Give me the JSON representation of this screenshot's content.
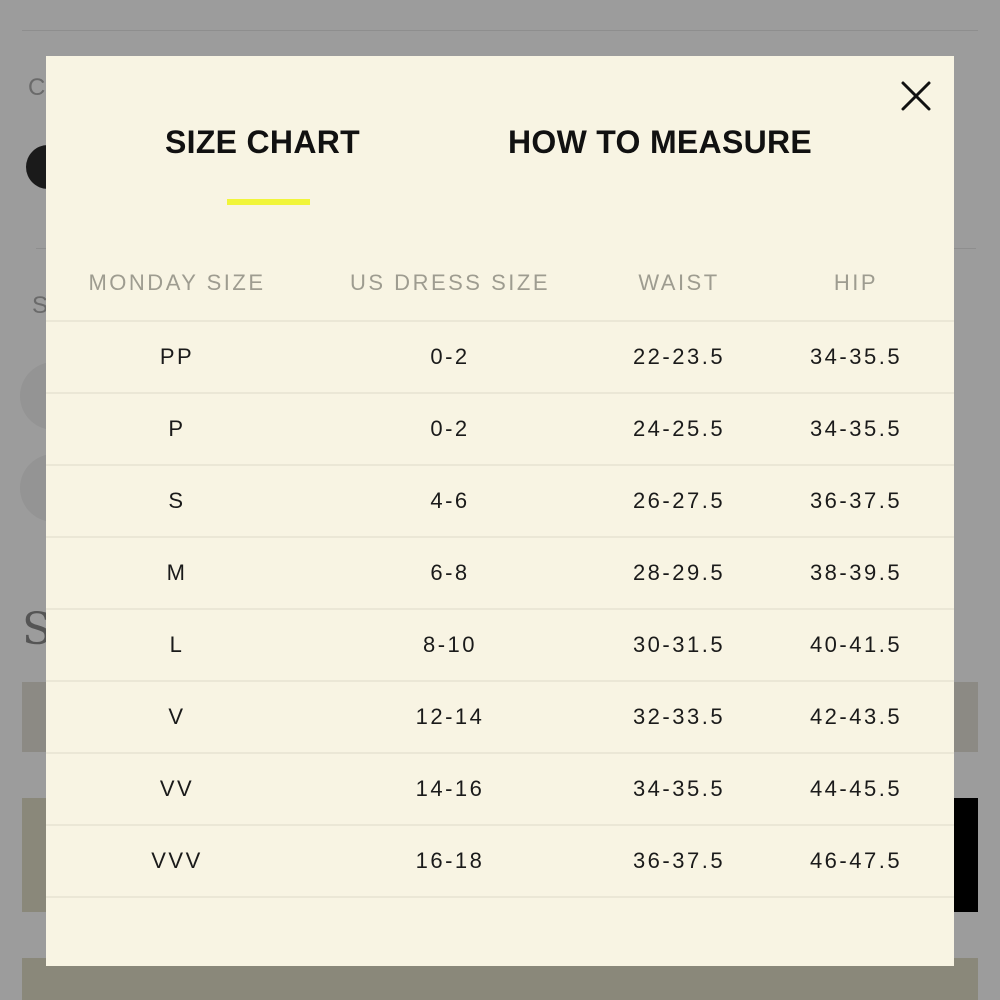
{
  "background_page": {
    "label_c": "C",
    "label_s": "S",
    "heading_s": "S"
  },
  "modal": {
    "close_icon": "close-icon",
    "tabs": [
      {
        "label": "SIZE CHART",
        "active": true
      },
      {
        "label": "HOW TO MEASURE",
        "active": false
      }
    ],
    "accent_color": "#f1f53a",
    "table": {
      "headers": [
        "MONDAY SIZE",
        "US DRESS SIZE",
        "WAIST",
        "HIP"
      ],
      "rows": [
        [
          "PP",
          "0-2",
          "22-23.5",
          "34-35.5"
        ],
        [
          "P",
          "0-2",
          "24-25.5",
          "34-35.5"
        ],
        [
          "S",
          "4-6",
          "26-27.5",
          "36-37.5"
        ],
        [
          "M",
          "6-8",
          "28-29.5",
          "38-39.5"
        ],
        [
          "L",
          "8-10",
          "30-31.5",
          "40-41.5"
        ],
        [
          "V",
          "12-14",
          "32-33.5",
          "42-43.5"
        ],
        [
          "VV",
          "14-16",
          "34-35.5",
          "44-45.5"
        ],
        [
          "VVV",
          "16-18",
          "36-37.5",
          "46-47.5"
        ]
      ]
    }
  }
}
